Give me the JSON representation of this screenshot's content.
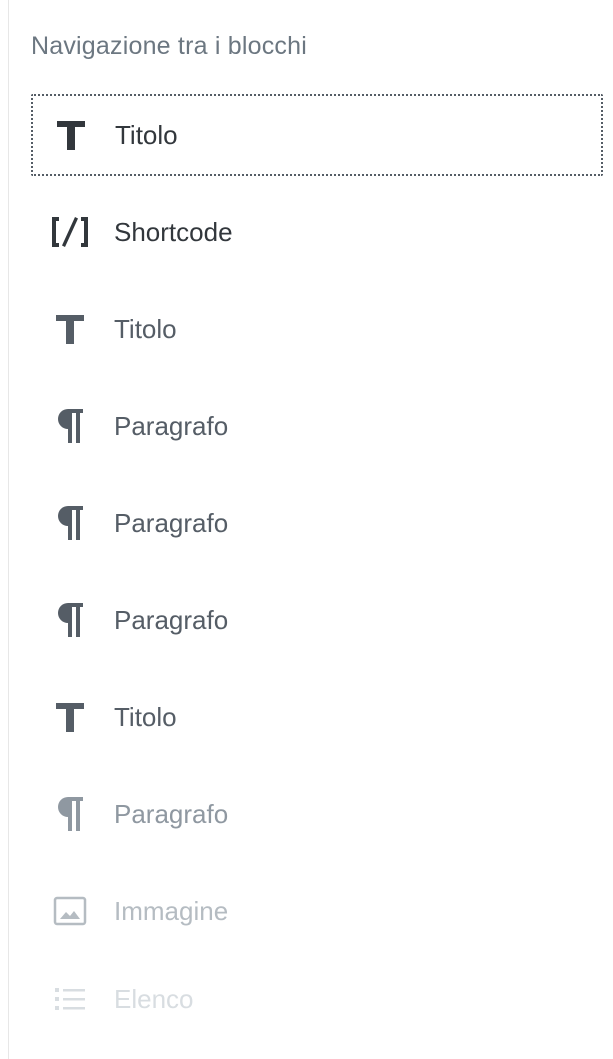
{
  "panel": {
    "title": "Navigazione tra i blocchi"
  },
  "blocks": [
    {
      "label": "Titolo",
      "icon": "heading-icon"
    },
    {
      "label": "Shortcode",
      "icon": "shortcode-icon"
    },
    {
      "label": "Titolo",
      "icon": "heading-icon"
    },
    {
      "label": "Paragrafo",
      "icon": "paragraph-icon"
    },
    {
      "label": "Paragrafo",
      "icon": "paragraph-icon"
    },
    {
      "label": "Paragrafo",
      "icon": "paragraph-icon"
    },
    {
      "label": "Titolo",
      "icon": "heading-icon"
    },
    {
      "label": "Paragrafo",
      "icon": "paragraph-icon"
    },
    {
      "label": "Immagine",
      "icon": "image-icon"
    },
    {
      "label": "Elenco",
      "icon": "list-icon"
    }
  ],
  "selected_index": 0,
  "colors": {
    "text": "#32373c",
    "title": "#6c7781",
    "border": "#e7e7e7"
  }
}
